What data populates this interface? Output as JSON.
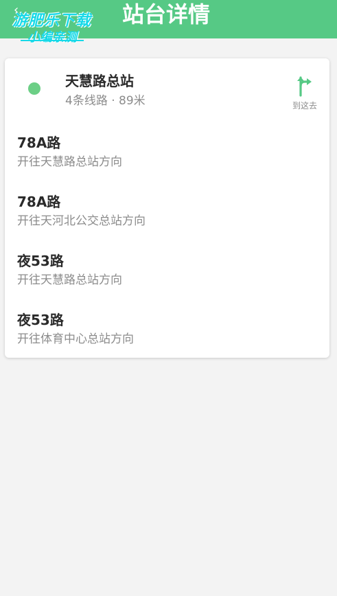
{
  "header": {
    "title": "站台详情",
    "back_glyph": "‹",
    "watermark_line1": "游肥乐下载",
    "watermark_line2": "小编亲测",
    "background_color": "#56c985"
  },
  "station": {
    "name": "天慧路总站",
    "meta": "4条线路 · 89米",
    "dot_color": "#6ccf86",
    "goto_label": "到这去",
    "goto_icon": "turn-right-arrow-icon"
  },
  "routes": [
    {
      "name": "78A路",
      "direction": "开往天慧路总站方向"
    },
    {
      "name": "78A路",
      "direction": "开往天河北公交总站方向"
    },
    {
      "name": "夜53路",
      "direction": "开往天慧路总站方向"
    },
    {
      "name": "夜53路",
      "direction": "开往体育中心总站方向"
    }
  ]
}
